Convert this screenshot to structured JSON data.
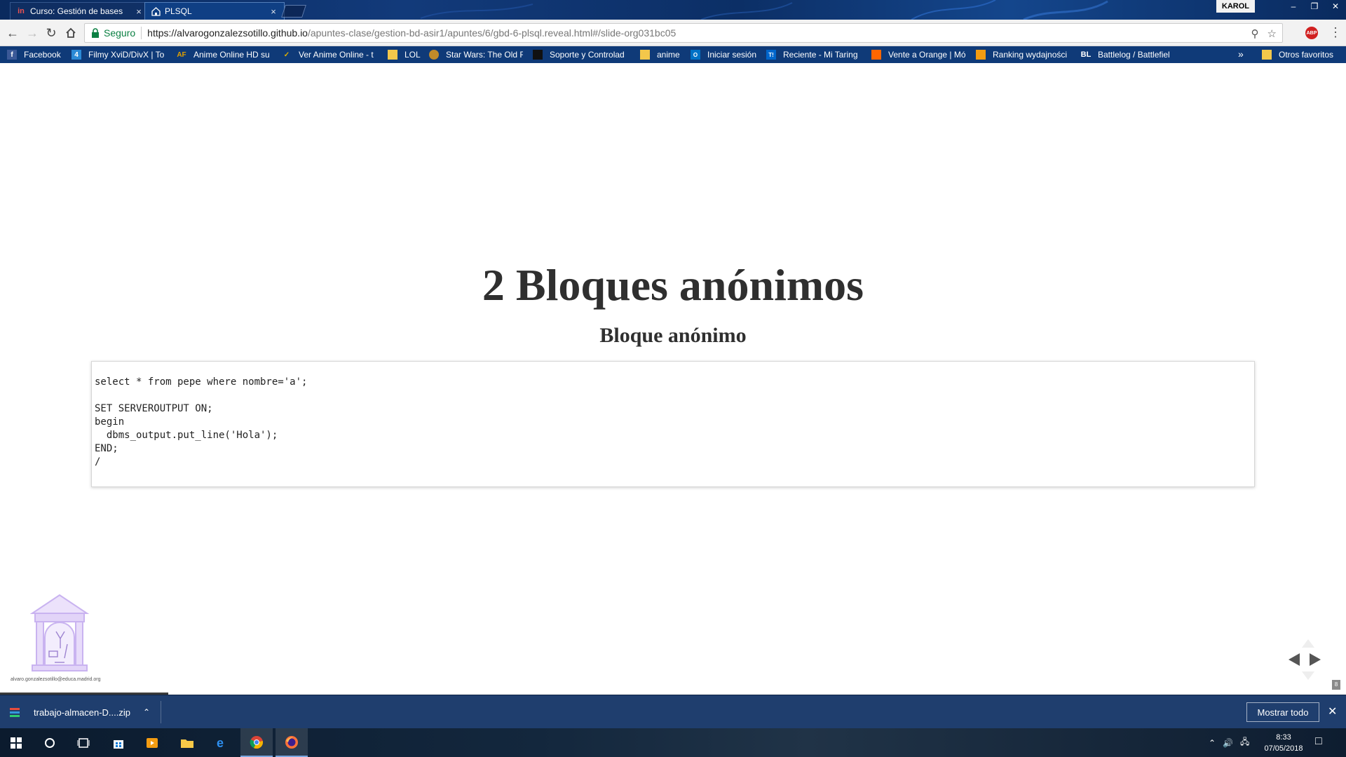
{
  "browser": {
    "tabs": [
      {
        "title": "Curso: Gestión de bases",
        "favicon": "in",
        "active": false
      },
      {
        "title": "PLSQL",
        "favicon": "house-icon",
        "active": true
      }
    ],
    "profile_name": "KAROL",
    "window_controls": {
      "minimize": "–",
      "restore": "❐",
      "close": "✕"
    },
    "secure_label": "Seguro",
    "url_host": "https://alvarogonzalezsotillo.github.io",
    "url_path": "/apuntes-clase/gestion-bd-asir1/apuntes/6/gbd-6-plsql.reveal.html#/slide-org031bc05",
    "extension_badge": "ABP"
  },
  "bookmarks": [
    {
      "label": "Facebook",
      "icon": "f",
      "color": "#3b5998"
    },
    {
      "label": "Filmy XviD/DivX | To",
      "icon": "4",
      "color": "#2b8ad6"
    },
    {
      "label": "Anime Online HD su",
      "icon": "AF",
      "color": "#1d1d1d"
    },
    {
      "label": "Ver Anime Online - t",
      "icon": "✓",
      "color": "#e0b000"
    },
    {
      "label": "LOL",
      "icon": "folder",
      "color": "#f3c74b"
    },
    {
      "label": "Star Wars: The Old R",
      "icon": "◉",
      "color": "#c08a2a"
    },
    {
      "label": "Soporte y Controlad",
      "icon": "◆",
      "color": "#000000"
    },
    {
      "label": "anime",
      "icon": "folder",
      "color": "#f3c74b"
    },
    {
      "label": "Iniciar sesión",
      "icon": "O",
      "color": "#0072c6"
    },
    {
      "label": "Reciente - Mi Taring",
      "icon": "T!",
      "color": "#0066cc"
    },
    {
      "label": "Vente a Orange | Mó",
      "icon": "or",
      "color": "#ff6600"
    },
    {
      "label": "Ranking wydajności",
      "icon": "≡",
      "color": "#f39c12"
    },
    {
      "label": "Battlelog / Battlefiel",
      "icon": "BL",
      "color": "#1a1a1a"
    }
  ],
  "bookmarks_more": "»",
  "bookmarks_other": "Otros favoritos",
  "slide": {
    "title": "2 Bloques anónimos",
    "subtitle": "Bloque anónimo",
    "code": "select * from pepe where nombre='a';\n\nSET SERVEROUTPUT ON;\nbegin\n  dbms_output.put_line('Hola');\nEND;\n/",
    "footer_email": "alvaro.gonzalezsotillo@educa.madrid.org",
    "slide_number": "8"
  },
  "download": {
    "filename": "trabajo-almacen-D....zip",
    "show_all": "Mostrar todo"
  },
  "taskbar": {
    "apps": [
      "windows-start-icon",
      "cortana-icon",
      "task-view-icon",
      "store-icon",
      "media-player-icon",
      "file-explorer-icon",
      "edge-icon",
      "chrome-icon",
      "firefox-icon"
    ],
    "time": "8:33",
    "date": "07/05/2018"
  }
}
